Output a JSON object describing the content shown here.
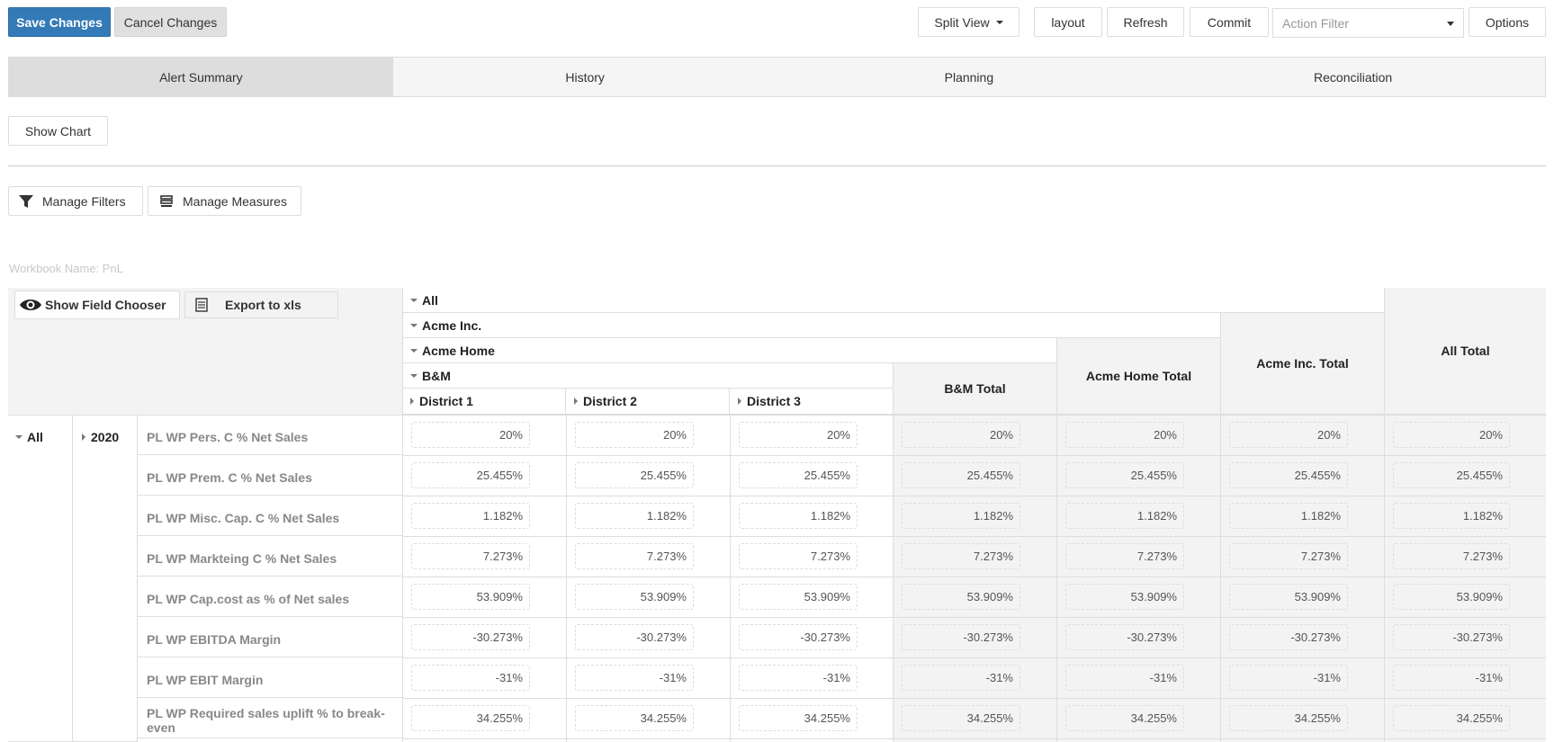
{
  "toolbar": {
    "save_label": "Save Changes",
    "cancel_label": "Cancel Changes",
    "split_view_label": "Split View",
    "layout_label": "layout",
    "refresh_label": "Refresh",
    "commit_label": "Commit",
    "action_filter_placeholder": "Action Filter",
    "options_label": "Options"
  },
  "tabs": [
    {
      "label": "Alert Summary",
      "active": true
    },
    {
      "label": "History",
      "active": false
    },
    {
      "label": "Planning",
      "active": false
    },
    {
      "label": "Reconciliation",
      "active": false
    }
  ],
  "show_chart_label": "Show Chart",
  "manage_filters_label": "Manage Filters",
  "manage_measures_label": "Manage Measures",
  "workbook_name": "Workbook Name: PnL",
  "pivot": {
    "show_field_chooser_label": "Show Field Chooser",
    "export_label": "Export to xls",
    "col_headers": {
      "all": "All",
      "acme_inc": "Acme Inc.",
      "acme_home": "Acme Home",
      "bm": "B&M",
      "district1": "District 1",
      "district2": "District 2",
      "district3": "District 3",
      "bm_total": "B&M Total",
      "acme_home_total": "Acme Home Total",
      "acme_inc_total": "Acme Inc. Total",
      "all_total": "All Total"
    },
    "row_headers": {
      "all": "All",
      "year": "2020"
    },
    "rows": [
      {
        "label": "PL WP Pers. C % Net Sales",
        "value": "20%"
      },
      {
        "label": "PL WP Prem. C % Net Sales",
        "value": "25.455%"
      },
      {
        "label": "PL WP Misc. Cap. C % Net Sales",
        "value": "1.182%"
      },
      {
        "label": "PL WP Markteing C % Net Sales",
        "value": "7.273%"
      },
      {
        "label": "PL WP Cap.cost as % of Net sales",
        "value": "53.909%"
      },
      {
        "label": "PL WP EBITDA Margin",
        "value": "-30.273%"
      },
      {
        "label": "PL WP EBIT Margin",
        "value": "-31%"
      },
      {
        "label": "PL WP Required sales uplift % to break-even",
        "value": "34.255%"
      }
    ]
  }
}
